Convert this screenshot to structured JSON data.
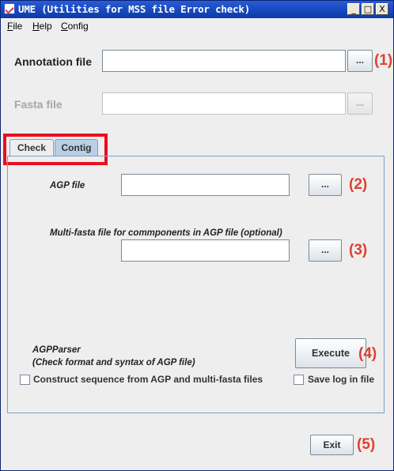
{
  "window": {
    "title": "UME (Utilities for MSS file Error check)",
    "controls": {
      "minimize": "_",
      "maximize": "□",
      "close": "X"
    }
  },
  "menu": {
    "items": [
      {
        "label": "File",
        "mnemonic": "F",
        "rest": "ile"
      },
      {
        "label": "Help",
        "mnemonic": "H",
        "rest": "elp"
      },
      {
        "label": "Config",
        "mnemonic": "C",
        "rest": "onfig"
      }
    ]
  },
  "annotation": {
    "label": "Annotation file",
    "value": "",
    "browse_label": "...",
    "marker": "(1)"
  },
  "fasta": {
    "label": "Fasta  file",
    "value": "",
    "browse_label": "..."
  },
  "tabs": [
    {
      "label": "Check",
      "active": false
    },
    {
      "label": "Contig",
      "active": true
    }
  ],
  "contig": {
    "agp_label": "AGP file",
    "agp_value": "",
    "agp_browse": "...",
    "agp_marker": "(2)",
    "multifasta_label": "Multi-fasta file for commponents in AGP file (optional)",
    "multifasta_value": "",
    "multifasta_browse": "...",
    "multifasta_marker": "(3)",
    "parser_title": "AGPParser",
    "parser_desc": "(Check format and syntax of AGP file)",
    "execute_label": "Execute",
    "execute_marker": "(4)",
    "construct_label": "Construct sequence from AGP and multi-fasta files",
    "construct_checked": false,
    "savelog_label": "Save log in file",
    "savelog_checked": false
  },
  "footer": {
    "exit_label": "Exit",
    "exit_marker": "(5)"
  },
  "colors": {
    "highlight": "#e8101f",
    "marker": "#e04030",
    "active_tab": "#b8cfe5",
    "titlebar": "#0b3aa8"
  }
}
